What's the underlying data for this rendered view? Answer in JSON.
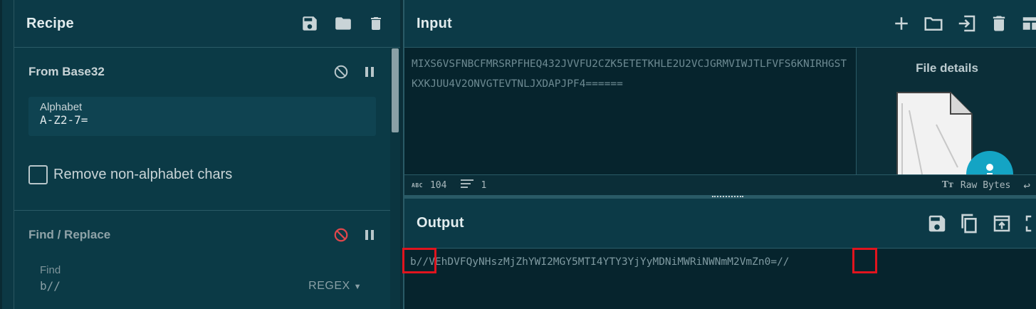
{
  "recipe": {
    "title": "Recipe",
    "icons": [
      "save-icon",
      "folder-icon",
      "trash-icon"
    ],
    "operations": [
      {
        "title": "From Base32",
        "disabled": false,
        "args": {
          "alphabet_label": "Alphabet",
          "alphabet_value": "A-Z2-7="
        },
        "checkbox_label": "Remove non-alphabet chars",
        "checkbox_checked": false
      },
      {
        "title": "Find / Replace",
        "disabled": true,
        "find_label": "Find",
        "find_value": "b//",
        "find_type": "REGEX"
      }
    ]
  },
  "input": {
    "title": "Input",
    "text": "MIXS6VSFNBCFMRSRPFHEQ432JVVFU2CZK5ETETKHLE2U2VCJGRMVIWJTLFVFS6KNIRHGSTKXKJUU4V2ONVGTEVTNLJXDAPJPF4======",
    "icons": [
      "plus-icon",
      "folder-icon",
      "import-icon",
      "trash-icon",
      "layout-icon"
    ],
    "file_details_title": "File details",
    "status": {
      "abc_label": "ABC",
      "length": "104",
      "lines": "1",
      "encoding": "Raw Bytes"
    }
  },
  "output": {
    "title": "Output",
    "prefix": "b//",
    "middle": "VEhDVFQyNHszMjZhYWI2MGY5MTI4YTY3YjYyMDNiMWRiNWNmM2VmZn0=",
    "suffix": "//",
    "icons": [
      "save-icon",
      "copy-icon",
      "replace-input-icon",
      "maximize-icon"
    ],
    "highlight_color": "#e0141e"
  },
  "colors": {
    "background": "#0b2e38",
    "panel": "#0b3a46",
    "disabled_icon": "#e0474c"
  }
}
